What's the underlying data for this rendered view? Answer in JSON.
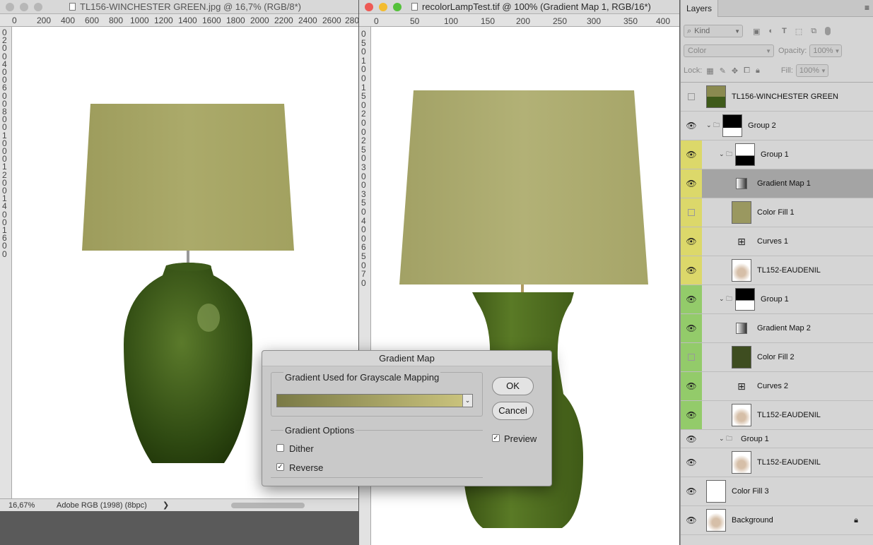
{
  "doc1": {
    "title": "TL156-WINCHESTER GREEN.jpg @ 16,7% (RGB/8*)",
    "hruler": [
      "0",
      "200",
      "400",
      "600",
      "800",
      "1000",
      "1200",
      "1400",
      "1600",
      "1800",
      "2000",
      "2200",
      "2400",
      "2600",
      "280"
    ],
    "vruler": [
      "0",
      "2",
      "0",
      "0",
      "4",
      "0",
      "0",
      "6",
      "0",
      "0",
      "8",
      "0",
      "0",
      "1",
      "0",
      "0",
      "0",
      "1",
      "2",
      "0",
      "0",
      "1",
      "4",
      "0",
      "0",
      "1",
      "6",
      "0",
      "0"
    ],
    "zoom": "16,67%",
    "profile": "Adobe RGB (1998) (8bpc)",
    "arrow": "❯"
  },
  "doc2": {
    "title": "recolorLampTest.tif @ 100% (Gradient Map 1, RGB/16*)",
    "hruler": [
      "0",
      "50",
      "100",
      "150",
      "200",
      "250",
      "300",
      "350",
      "400"
    ],
    "vruler": [
      "0",
      "5",
      "0",
      "1",
      "0",
      "0",
      "1",
      "5",
      "0",
      "2",
      "0",
      "0",
      "2",
      "5",
      "0",
      "3",
      "0",
      "0",
      "3",
      "5",
      "0",
      "4",
      "0",
      "0",
      "6",
      "5",
      "0",
      "7",
      "0"
    ]
  },
  "layers_panel": {
    "tab": "Layers",
    "filter_kind": "Kind",
    "blend_mode": "Color",
    "opacity_label": "Opacity:",
    "opacity_value": "100%",
    "lock_label": "Lock:",
    "fill_label": "Fill:",
    "fill_value": "100%",
    "layers": [
      {
        "name": "TL156-WINCHESTER GREEN",
        "visible": false,
        "tag": ""
      },
      {
        "name": "Group 2",
        "visible": true,
        "tag": ""
      },
      {
        "name": "Group 1",
        "visible": true,
        "tag": "yellow"
      },
      {
        "name": "Gradient Map 1",
        "visible": true,
        "tag": "yellow"
      },
      {
        "name": "Color Fill 1",
        "visible": false,
        "tag": "yellow"
      },
      {
        "name": "Curves 1",
        "visible": true,
        "tag": "yellow"
      },
      {
        "name": "TL152-EAUDENIL",
        "visible": true,
        "tag": "yellow"
      },
      {
        "name": "Group 1",
        "visible": true,
        "tag": "green"
      },
      {
        "name": "Gradient Map 2",
        "visible": true,
        "tag": "green"
      },
      {
        "name": "Color Fill 2",
        "visible": false,
        "tag": "green"
      },
      {
        "name": "Curves 2",
        "visible": true,
        "tag": "green"
      },
      {
        "name": "TL152-EAUDENIL",
        "visible": true,
        "tag": "green"
      },
      {
        "name": "Group 1",
        "visible": true,
        "tag": ""
      },
      {
        "name": "TL152-EAUDENIL",
        "visible": true,
        "tag": ""
      },
      {
        "name": "Color Fill 3",
        "visible": true,
        "tag": ""
      },
      {
        "name": "Background",
        "visible": true,
        "tag": ""
      }
    ]
  },
  "dialog": {
    "title": "Gradient Map",
    "gradient_group": "Gradient Used for Grayscale Mapping",
    "options_group": "Gradient Options",
    "dither_label": "Dither",
    "dither_checked": false,
    "reverse_label": "Reverse",
    "reverse_checked": true,
    "ok": "OK",
    "cancel": "Cancel",
    "preview_label": "Preview",
    "preview_checked": true,
    "gradient_start": "#7a7a46",
    "gradient_end": "#c9c27c"
  },
  "colors": {
    "shade": "#a6a565",
    "vase": "#3e5a1a",
    "tag_yellow": "#dcd86a",
    "tag_green": "#93cb6a",
    "selected": "#a4a4a4",
    "fill1": "#9a9860",
    "fill2": "#3e4d20"
  }
}
